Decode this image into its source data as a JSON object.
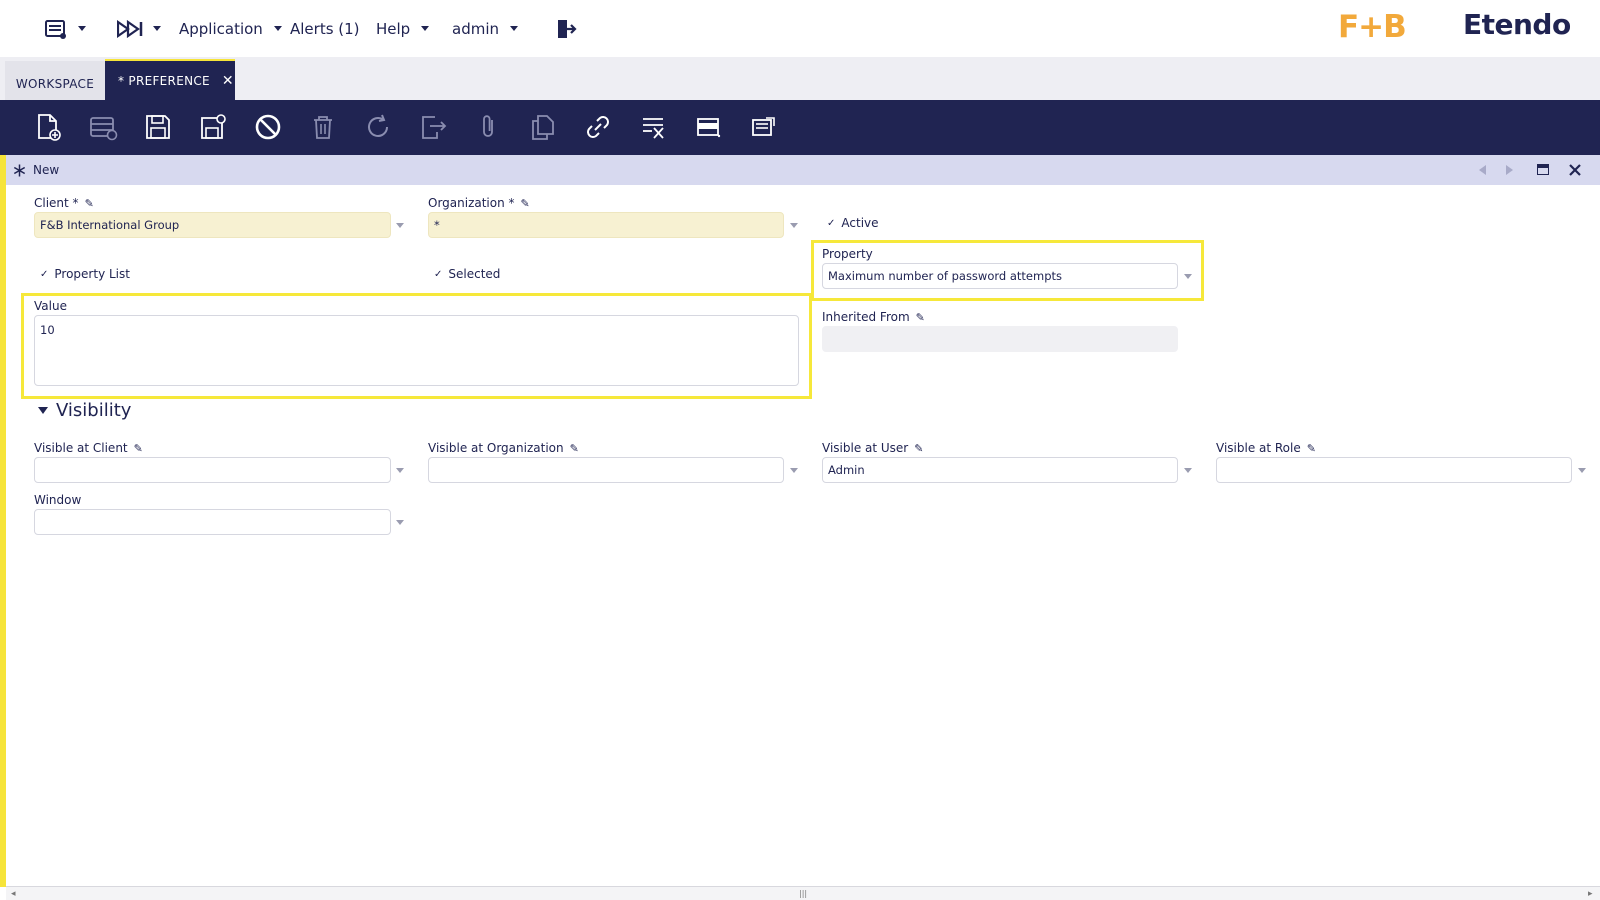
{
  "topbar": {
    "application": "Application",
    "alerts": "Alerts (1)",
    "help": "Help",
    "user": "admin",
    "logo_fb": "F+B",
    "logo_brand": "Etendo"
  },
  "tabs": [
    {
      "label": "WORKSPACE"
    },
    {
      "label": "* PREFERENCE",
      "close": "✕"
    }
  ],
  "toolbar": {
    "icons": [
      "new-document-icon",
      "new-row-icon",
      "save-icon",
      "save-close-icon",
      "undo-icon",
      "delete-icon",
      "refresh-icon",
      "export-icon",
      "attach-icon",
      "copy-icon",
      "link-icon",
      "filter-icon",
      "grid-view-icon",
      "notes-icon"
    ]
  },
  "form_header": {
    "status": "New"
  },
  "form": {
    "client_label": "Client *",
    "client_value": "F&B International Group",
    "organization_label": "Organization *",
    "organization_value": "*",
    "active_label": "Active",
    "property_list_label": "Property List",
    "selected_label": "Selected",
    "property_label": "Property",
    "property_value": "Maximum number of password attempts",
    "value_label": "Value",
    "value_value": "10",
    "inherited_from_label": "Inherited From",
    "inherited_from_value": ""
  },
  "visibility": {
    "title": "Visibility",
    "visible_at_client_label": "Visible at Client",
    "visible_at_client_value": "",
    "visible_at_org_label": "Visible at Organization",
    "visible_at_org_value": "",
    "visible_at_user_label": "Visible at User",
    "visible_at_user_value": "Admin",
    "visible_at_role_label": "Visible at Role",
    "visible_at_role_value": "",
    "window_label": "Window",
    "window_value": ""
  },
  "colors": {
    "primary": "#202452",
    "highlight": "#f6e83a",
    "required_bg": "#f7f1d2",
    "header_strip": "#d7d9ef"
  }
}
